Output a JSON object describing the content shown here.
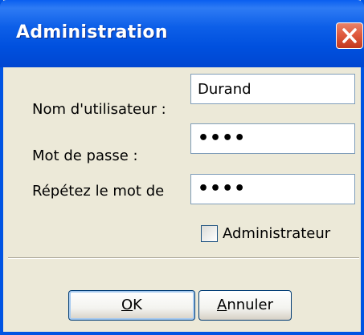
{
  "window": {
    "title": "Administration"
  },
  "titlebar": {
    "close_icon": "close-icon"
  },
  "form": {
    "username": {
      "label": "Nom d'utilisateur :",
      "value": "Durand"
    },
    "password": {
      "label": "Mot de passe :",
      "value": "••••"
    },
    "confirm_password": {
      "label": "Répétez le mot de",
      "value": "••••"
    },
    "admin_checkbox": {
      "label": "Administrateur",
      "checked": false
    }
  },
  "buttons": {
    "ok": {
      "mnemonic": "O",
      "rest": "K"
    },
    "cancel": {
      "mnemonic": "A",
      "rest": "nnuler"
    }
  },
  "colors": {
    "titlebar": "#0054e3",
    "close_button": "#e05b3f",
    "dialog_background": "#ece9d8",
    "field_border": "#7f9db9"
  }
}
